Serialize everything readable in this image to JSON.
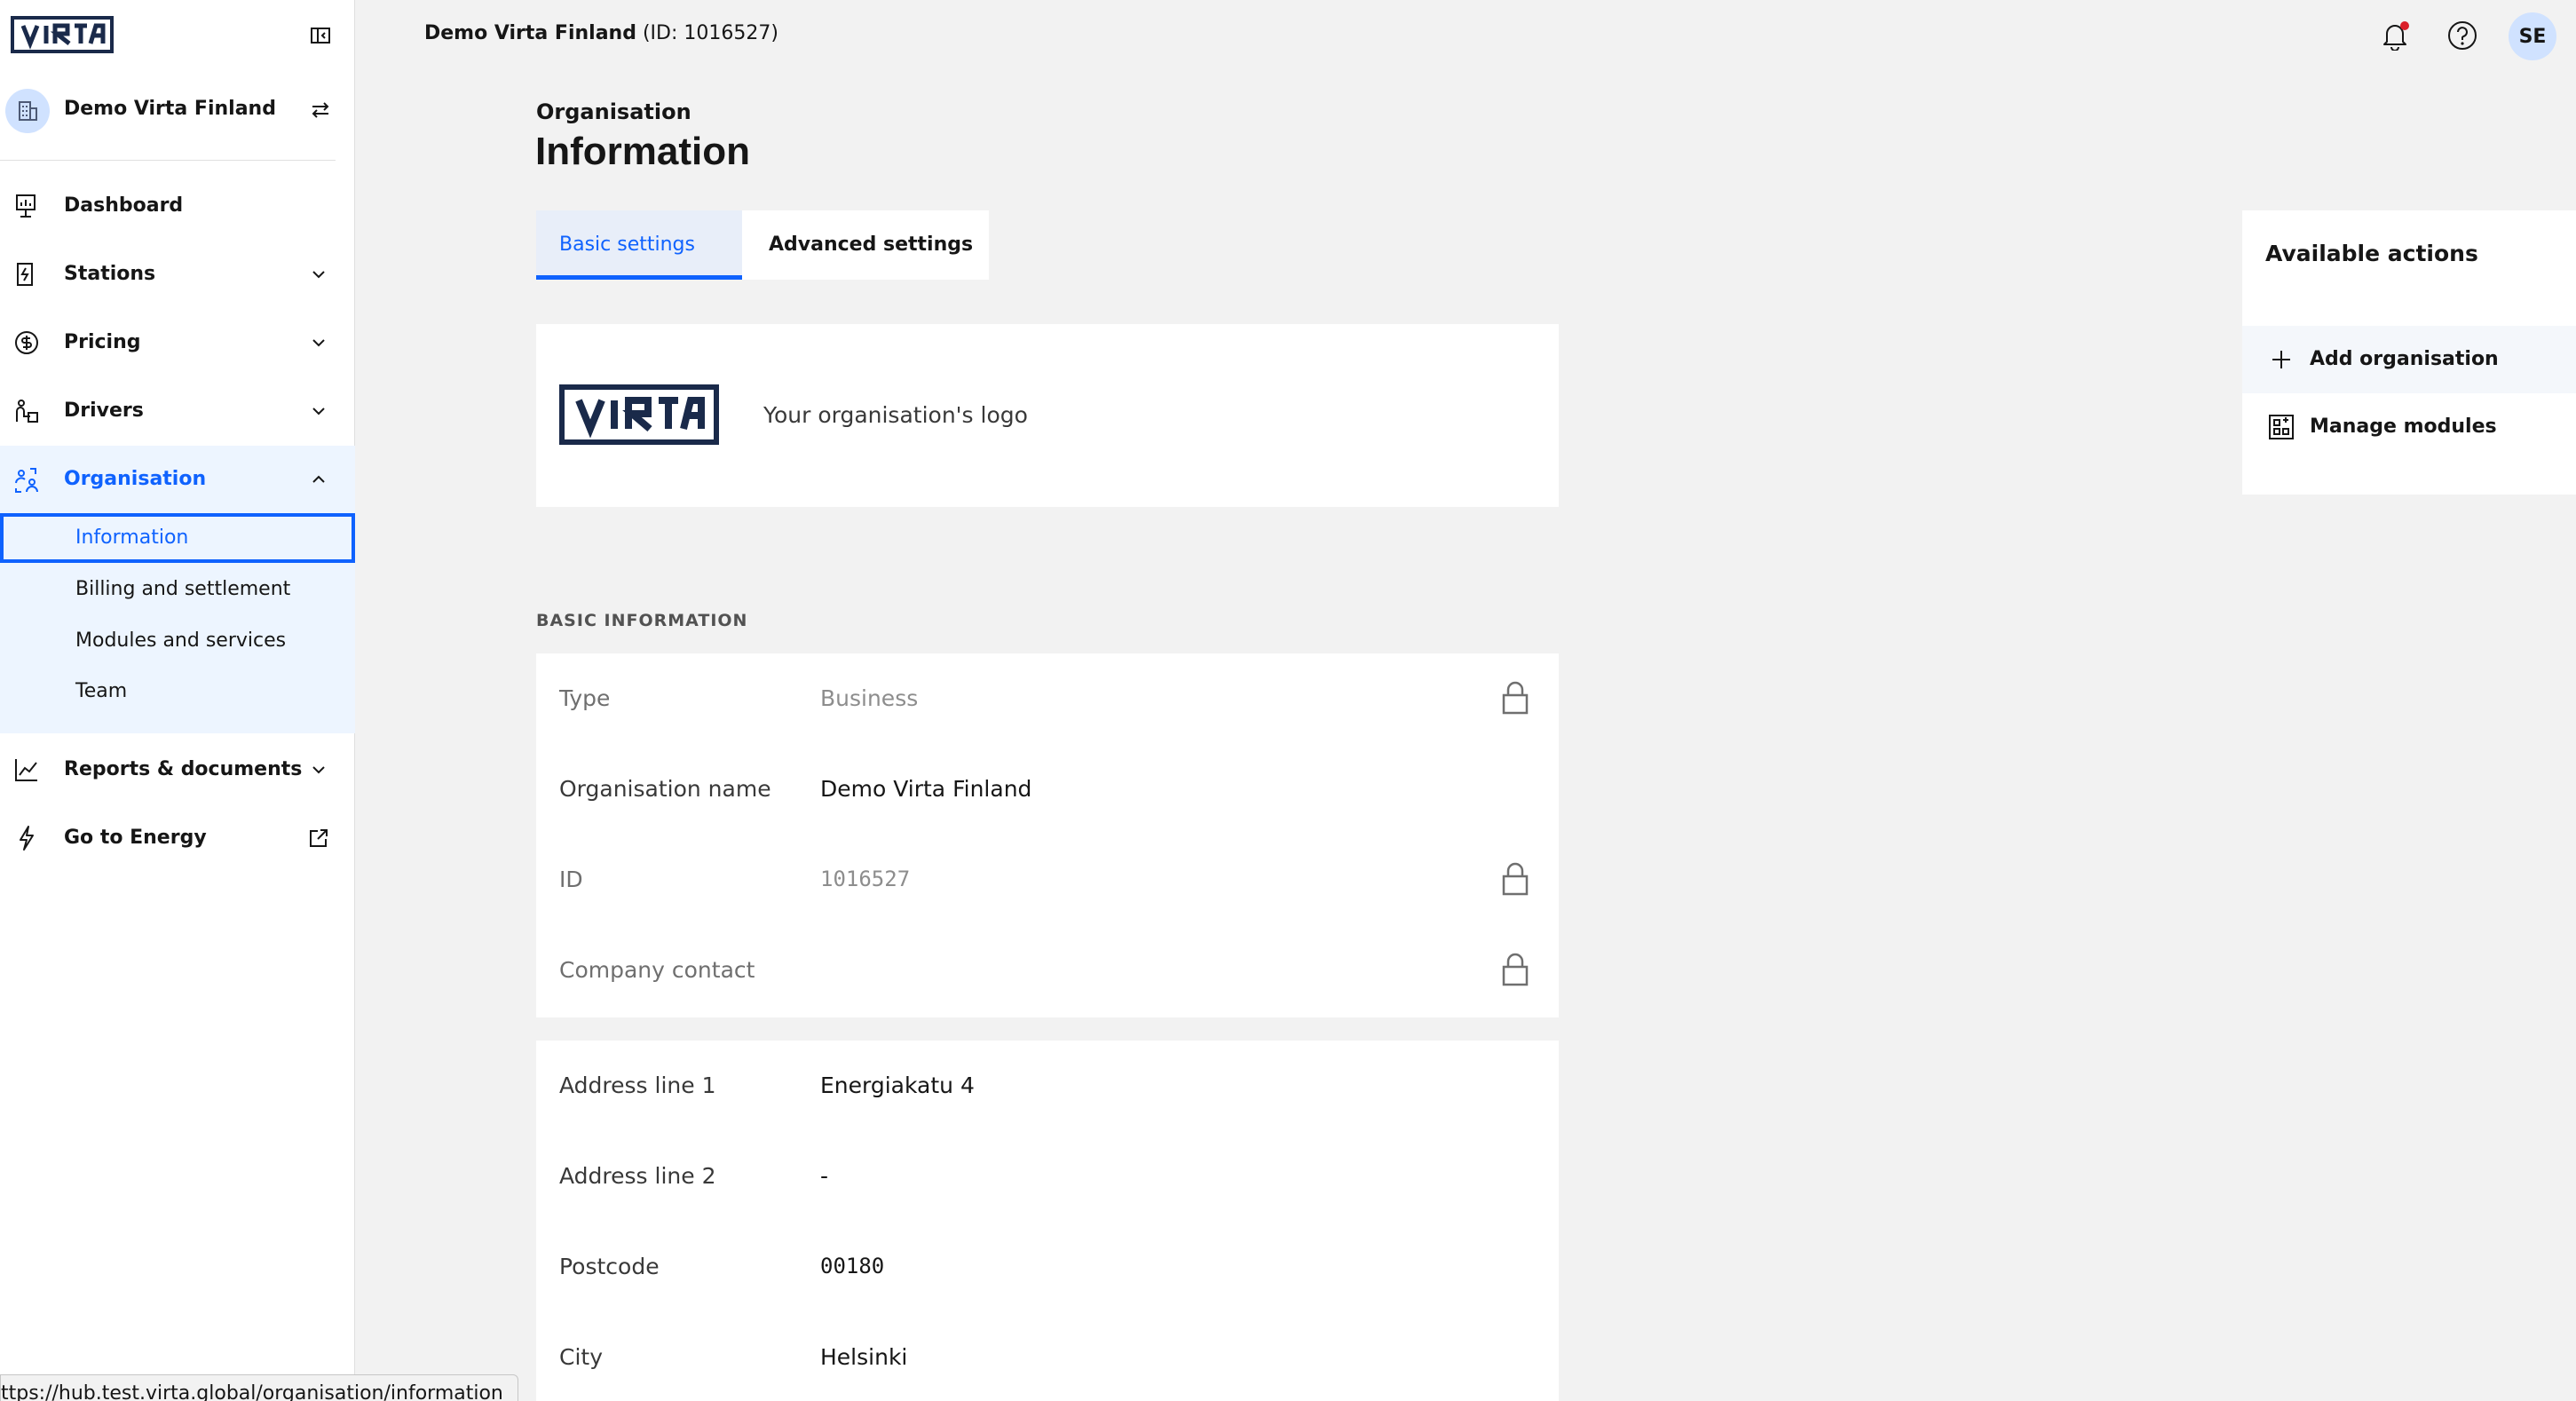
{
  "header": {
    "org_name": "Demo Virta Finland",
    "org_id_text": "(ID: 1016527)",
    "user_initials": "SE"
  },
  "sidebar": {
    "org_name": "Demo Virta Finland",
    "nav": [
      {
        "label": "Dashboard"
      },
      {
        "label": "Stations"
      },
      {
        "label": "Pricing"
      },
      {
        "label": "Drivers"
      },
      {
        "label": "Organisation"
      },
      {
        "label": "Reports & documents"
      },
      {
        "label": "Go to Energy"
      }
    ],
    "org_sub": [
      {
        "label": "Information"
      },
      {
        "label": "Billing and settlement"
      },
      {
        "label": "Modules and services"
      },
      {
        "label": "Team"
      }
    ]
  },
  "page": {
    "eyebrow": "Organisation",
    "title": "Information",
    "tabs": [
      {
        "label": "Basic settings"
      },
      {
        "label": "Advanced settings"
      }
    ],
    "logo_caption": "Your organisation's logo",
    "section_label": "BASIC INFORMATION",
    "basic_fields": [
      {
        "label": "Type",
        "value": "Business"
      },
      {
        "label": "Organisation name",
        "value": "Demo Virta Finland"
      },
      {
        "label": "ID",
        "value": "1016527"
      },
      {
        "label": "Company contact",
        "value": ""
      }
    ],
    "address_fields": [
      {
        "label": "Address line 1",
        "value": "Energiakatu 4"
      },
      {
        "label": "Address line 2",
        "value": "-"
      },
      {
        "label": "Postcode",
        "value": "00180"
      },
      {
        "label": "City",
        "value": "Helsinki"
      }
    ]
  },
  "actions": {
    "title": "Available actions",
    "items": [
      {
        "label": "Add organisation"
      },
      {
        "label": "Manage modules"
      }
    ]
  },
  "status_url": "ttps://hub.test.virta.global/organisation/information",
  "colors": {
    "accent": "#0f62fe",
    "brand_navy": "#1a2a4a",
    "alert": "#da1e28"
  }
}
